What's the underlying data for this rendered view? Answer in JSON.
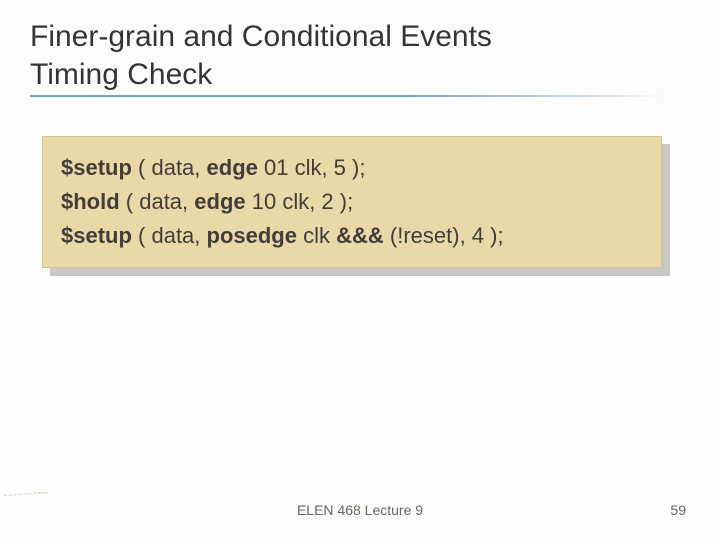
{
  "title_line1": "Finer-grain and Conditional Events",
  "title_line2": "Timing Check",
  "code": {
    "l1": {
      "p1": "$setup",
      "p2": " ( data, ",
      "p3": "edge",
      "p4": " 01 clk, 5 );"
    },
    "l2": {
      "p1": "$hold",
      "p2": " ( data, ",
      "p3": "edge",
      "p4": " 10 clk, 2 );"
    },
    "l3": {
      "p1": "$setup",
      "p2": " ( data, ",
      "p3": "posedge",
      "p4": " clk ",
      "p5": "&&&",
      "p6": " (!reset), 4 );"
    }
  },
  "footer": "ELEN 468 Lecture 9",
  "page": "59"
}
